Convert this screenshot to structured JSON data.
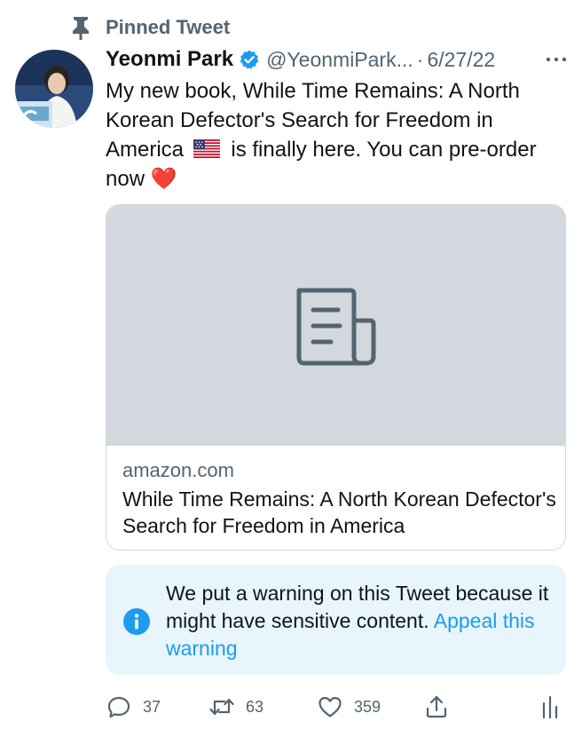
{
  "pinned": {
    "label": "Pinned Tweet"
  },
  "tweet": {
    "display_name": "Yeonmi Park",
    "handle": "@YeonmiPark...",
    "separator": "·",
    "date": "6/27/22",
    "text_part1": "My new book, While Time Remains: A North Korean Defector's Search for Freedom in America",
    "text_part2": "is finally here. You can pre-order now",
    "heart_emoji": "❤️",
    "flag_icon": "us-flag-icon"
  },
  "card": {
    "domain": "amazon.com",
    "title": "While Time Remains: A North Korean Defector's Search for Freedom in America",
    "image_icon": "article-icon"
  },
  "warning": {
    "text": "We put a warning on this Tweet because it might have sensitive content.",
    "link": "Appeal this warning"
  },
  "actions": {
    "replies": "37",
    "retweets": "63",
    "likes": "359"
  },
  "colors": {
    "accent": "#1d9bf0",
    "muted": "#536471",
    "warning_bg": "#e8f5fd",
    "card_bg": "#d2d8dd"
  }
}
